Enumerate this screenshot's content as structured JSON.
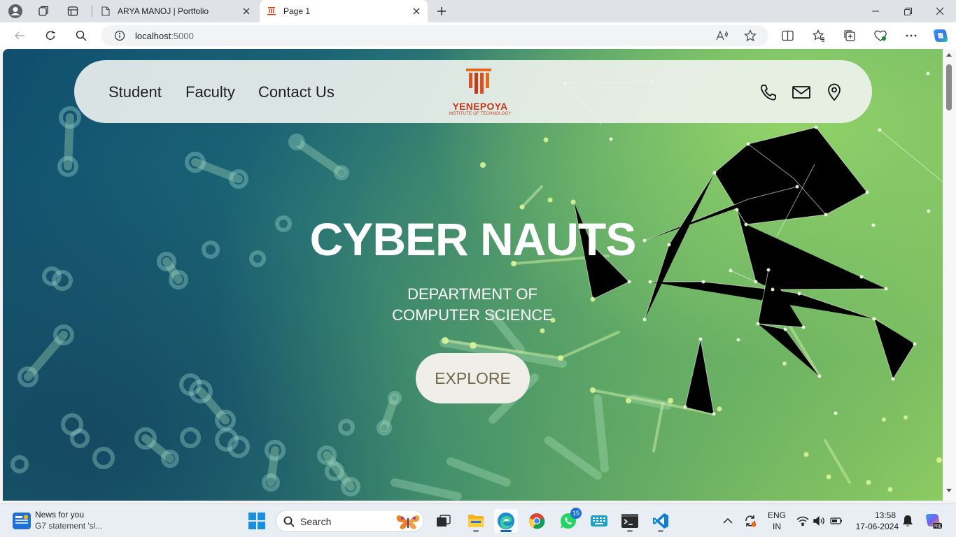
{
  "browser": {
    "tabs": [
      {
        "title": "ARYA MANOJ | Portfolio",
        "active": false
      },
      {
        "title": "Page 1",
        "active": true
      }
    ],
    "url": {
      "host": "localhost",
      "port": ":5000"
    }
  },
  "page": {
    "nav": {
      "links": [
        "Student",
        "Faculty",
        "Contact Us"
      ],
      "logo": {
        "name": "YENEPOYA",
        "subtitle": "INSTITUTE OF TECHNOLOGY"
      },
      "icons": [
        "phone-icon",
        "mail-icon",
        "location-icon"
      ]
    },
    "hero": {
      "title": "CYBER NAUTS",
      "subtitle": "DEPARTMENT OF COMPUTER SCIENCE",
      "button": "EXPLORE"
    },
    "colors": {
      "accent": "#c3391b",
      "button_bg": "#efeee9",
      "button_text": "#6e6848"
    }
  },
  "taskbar": {
    "news": {
      "title": "News for you",
      "detail": "G7 statement 'sl..."
    },
    "search_label": "Search",
    "whatsapp_badge": "15",
    "tray": {
      "lang": "ENG",
      "region": "IN",
      "time": "13:58",
      "date": "17-06-2024"
    }
  }
}
